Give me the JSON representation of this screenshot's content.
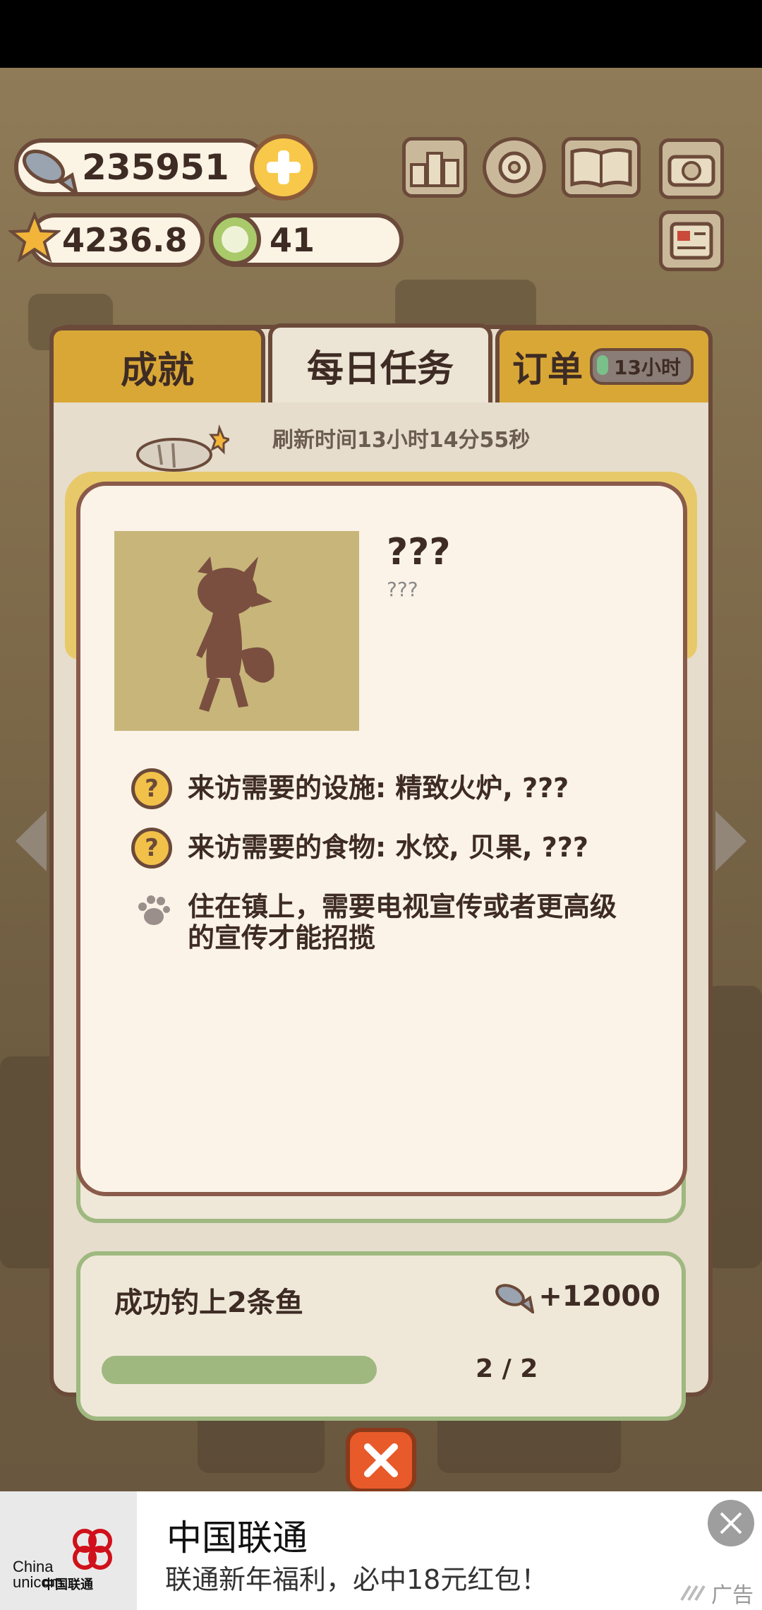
{
  "currency": {
    "fish": "235951",
    "stars": "4236.8",
    "coins": "41"
  },
  "tabs": [
    {
      "label": "成就"
    },
    {
      "label": "每日任务"
    },
    {
      "label": "订单"
    }
  ],
  "order_timer": "13小时",
  "refresh_text": "刷新时间13小时14分55秒",
  "modal": {
    "name": "???",
    "subtitle": "???",
    "requirements": [
      {
        "icon": "question-icon",
        "text": "来访需要的设施: 精致火炉, ???"
      },
      {
        "icon": "question-icon",
        "text": "来访需要的食物: 水饺, 贝果, ???"
      },
      {
        "icon": "paw-icon",
        "text": "住在镇上，需要电视宣传或者更高级的宣传才能招揽"
      }
    ]
  },
  "task": {
    "title": "成功钓上2条鱼",
    "reward": "+12000",
    "progress": "2 / 2"
  },
  "ad": {
    "brand_en": "China unicom",
    "brand_cn": "中国联通",
    "title": "中国联通",
    "subtitle": "联通新年福利，必中18元红包！",
    "label": "广告"
  },
  "colors": {
    "tab_inactive": "#d9a736",
    "panel_border": "#6b4a3a",
    "close_button": "#e85a2a",
    "progress_green": "#9fb880"
  }
}
